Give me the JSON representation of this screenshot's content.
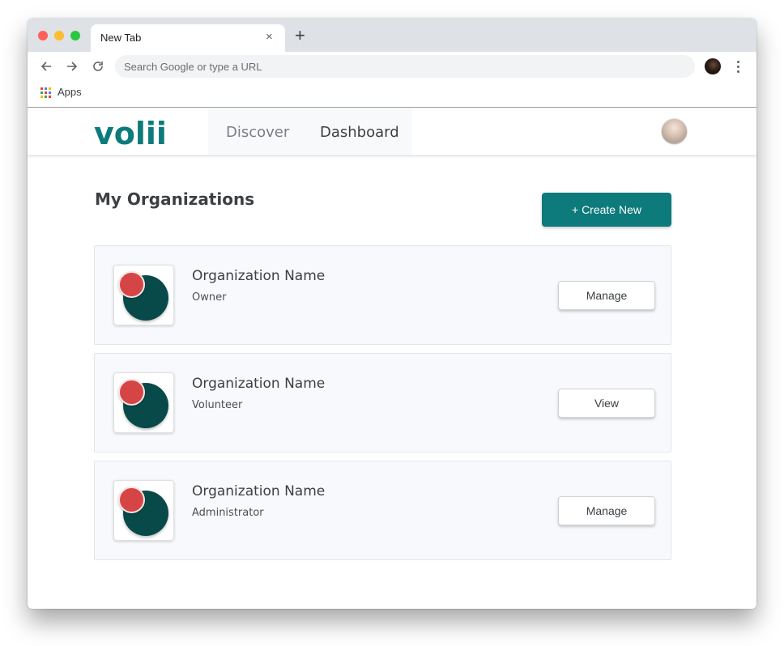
{
  "browser": {
    "tab_title": "New Tab",
    "close_glyph": "×",
    "new_tab_glyph": "+",
    "address_placeholder": "Search Google or type a URL",
    "bookmarks": {
      "apps_label": "Apps"
    }
  },
  "site": {
    "logo_text": "volii",
    "brand_color": "#0d7a7b",
    "nav": {
      "discover": "Discover",
      "dashboard": "Dashboard"
    },
    "active_nav": "Dashboard"
  },
  "page": {
    "title": "My Organizations",
    "create_button": "+ Create New"
  },
  "organizations": [
    {
      "name": "Organization Name",
      "role": "Owner",
      "action": "Manage"
    },
    {
      "name": "Organization Name",
      "role": "Volunteer",
      "action": "View"
    },
    {
      "name": "Organization Name",
      "role": "Administrator",
      "action": "Manage"
    }
  ],
  "colors": {
    "org_logo_primary": "#08494a",
    "org_logo_accent": "#d64545"
  }
}
